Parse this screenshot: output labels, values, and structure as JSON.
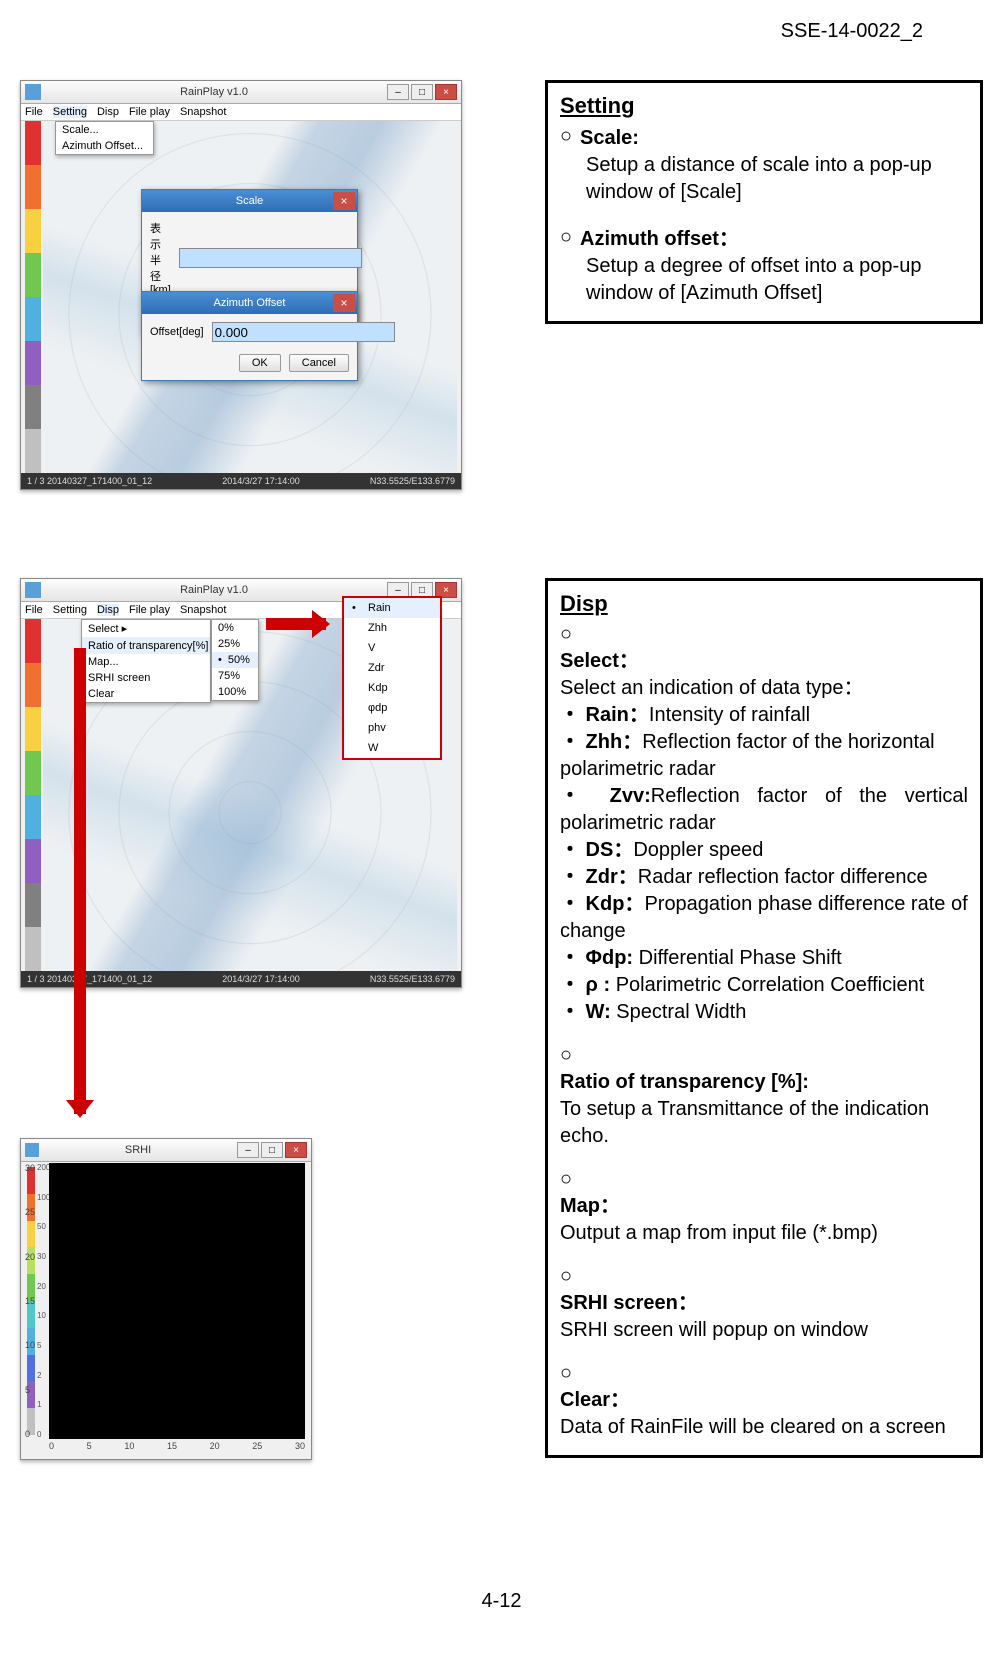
{
  "header": {
    "docid": "SSE-14-0022_2"
  },
  "footer": {
    "page": "4-12"
  },
  "fig1": {
    "app_title": "RainPlay v1.0",
    "menus": [
      "File",
      "Setting",
      "Disp",
      "File play",
      "Snapshot"
    ],
    "menu_highlight": 1,
    "dropdown": [
      "Scale...",
      "Azimuth Offset..."
    ],
    "scale_dialog": {
      "title": "Scale",
      "label": "表示半径[km]",
      "value": "",
      "ok": "OK",
      "cancel": "Cancel"
    },
    "azimuth_dialog": {
      "title": "Azimuth Offset",
      "label": "Offset[deg]",
      "value": "0.000",
      "ok": "OK",
      "cancel": "Cancel"
    },
    "status": {
      "left": "1 / 3     20140327_171400_01_12",
      "mid": "2014/3/27 17:14:00",
      "right": "N33.5525/E133.6779"
    },
    "scale_colors": [
      "#e03030",
      "#f07030",
      "#f8d040",
      "#70c850",
      "#50b0e0",
      "#9060c0",
      "#808080",
      "#c0c0c0"
    ]
  },
  "box1": {
    "title": "Setting",
    "scale_label": "Scale:",
    "scale_text": "Setup a distance of scale into a pop-up window of [Scale]",
    "az_label": "Azimuth offset：",
    "az_text": "Setup a degree of offset into a pop-up window of [Azimuth Offset]"
  },
  "fig2": {
    "app_title": "RainPlay v1.0",
    "menus": [
      "File",
      "Setting",
      "Disp",
      "File play",
      "Snapshot"
    ],
    "menu_highlight": 2,
    "disp_menu": [
      {
        "label": "Select",
        "arrow": true
      },
      {
        "label": "Ratio of transparency[%]",
        "arrow": true,
        "hi": true
      },
      {
        "label": "Map..."
      },
      {
        "label": "SRHI screen",
        "dot": true
      },
      {
        "label": "Clear"
      }
    ],
    "trans_menu": [
      "0%",
      "25%",
      "50%",
      "75%",
      "100%"
    ],
    "trans_selected": 2,
    "select_menu": [
      "Rain",
      "Zhh",
      "V",
      "Zdr",
      "Kdp",
      "φdp",
      "phv",
      "W"
    ],
    "select_selected": 0,
    "status": {
      "left": "1 / 3   20140327_171400_01_12",
      "mid": "2014/3/27 17:14:00",
      "right": "N33.5525/E133.6779"
    }
  },
  "fig3": {
    "title": "SRHI",
    "y_ticks": [
      "0",
      "5",
      "10",
      "15",
      "20",
      "25",
      "30"
    ],
    "x_ticks": [
      "0",
      "5",
      "10",
      "15",
      "20",
      "25",
      "30"
    ],
    "scale_labels": [
      "200",
      "100",
      "50",
      "30",
      "20",
      "10",
      "5",
      "2",
      "1",
      "0"
    ],
    "scale_colors": [
      "#e03030",
      "#f07030",
      "#f8d040",
      "#b8e060",
      "#70c850",
      "#50c8c8",
      "#50b0e0",
      "#5070e0",
      "#9060c0",
      "#c0c0c0"
    ]
  },
  "box2": {
    "title": "Disp",
    "select_label": "Select：",
    "select_text": "Select an indication of data type：",
    "items": [
      {
        "k": "Rain：",
        "v": "Intensity of rainfall"
      },
      {
        "k": "Zhh：",
        "v": "Reflection factor of the horizontal polarimetric radar"
      },
      {
        "k": "Zvv:",
        "v": "Reflection factor of the vertical polarimetric radar",
        "just": true
      },
      {
        "k": "DS：",
        "v": "Doppler speed"
      },
      {
        "k": "Zdr：",
        "v": "Radar reflection factor difference"
      },
      {
        "k": "Kdp：",
        "v": "Propagation phase difference rate of change"
      },
      {
        "k": "Φdp:",
        "v": "  Differential Phase Shift"
      },
      {
        "k": "ρ   :",
        "v": "  Polarimetric Correlation Coefficient"
      },
      {
        "k": "W:",
        "v": "  Spectral Width"
      }
    ],
    "ratio_label": "Ratio of transparency [%]:",
    "ratio_text": "To setup a Transmittance of the indication echo.",
    "map_label": "Map：",
    "map_text": "Output a map from input file (*.bmp)",
    "srhi_label": "SRHI screen：",
    "srhi_text": "SRHI screen will popup on window",
    "clear_label": "Clear：",
    "clear_text": "Data of RainFile will be cleared on a screen"
  }
}
